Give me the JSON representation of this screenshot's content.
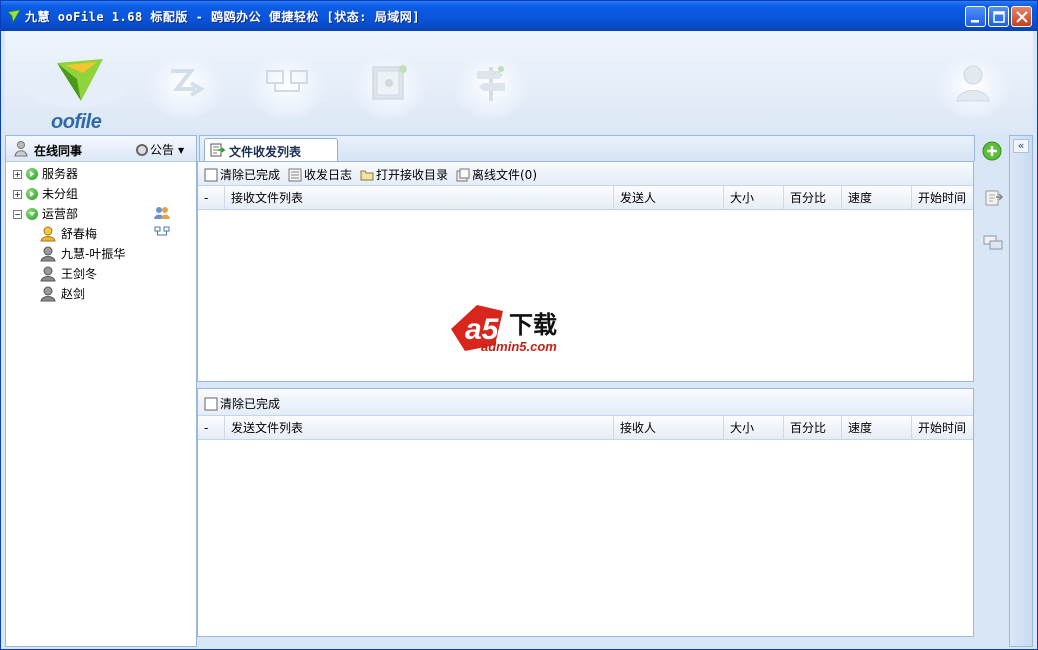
{
  "window": {
    "title": "九慧 ooFile 1.68 标配版 - 鸥鸥办公 便捷轻松 [状态: 局域网]"
  },
  "logo": {
    "text": "oofile"
  },
  "toolbar": {
    "buttons": [
      {
        "icon": "zap-transfer-icon"
      },
      {
        "icon": "network-computers-icon"
      },
      {
        "icon": "safe-icon"
      },
      {
        "icon": "signpost-icon"
      },
      {
        "icon": "user-profile-icon"
      }
    ]
  },
  "left": {
    "title": "在线同事",
    "notice_label": "公告",
    "tree": [
      {
        "label": "服务器",
        "type": "group",
        "expanded": false
      },
      {
        "label": "未分组",
        "type": "group",
        "expanded": false
      },
      {
        "label": "运营部",
        "type": "group",
        "expanded": true
      },
      {
        "label": "舒春梅",
        "type": "user",
        "online": true
      },
      {
        "label": "九慧-叶振华",
        "type": "user",
        "online": false
      },
      {
        "label": "王剑冬",
        "type": "user",
        "online": false
      },
      {
        "label": "赵剑",
        "type": "user",
        "online": false
      }
    ]
  },
  "tab": {
    "label": "文件收发列表"
  },
  "receive": {
    "actions": {
      "clear": "清除已完成",
      "log": "收发日志",
      "open_dir": "打开接收目录",
      "offline": "离线文件(0)"
    },
    "columns": [
      "-",
      "接收文件列表",
      "发送人",
      "大小",
      "百分比",
      "速度",
      "开始时间"
    ]
  },
  "send": {
    "actions": {
      "clear": "清除已完成"
    },
    "columns": [
      "-",
      "发送文件列表",
      "接收人",
      "大小",
      "百分比",
      "速度",
      "开始时间"
    ]
  },
  "watermark": {
    "brand": "下载",
    "site": "admin5.com"
  },
  "collapse": {
    "label": "«"
  }
}
